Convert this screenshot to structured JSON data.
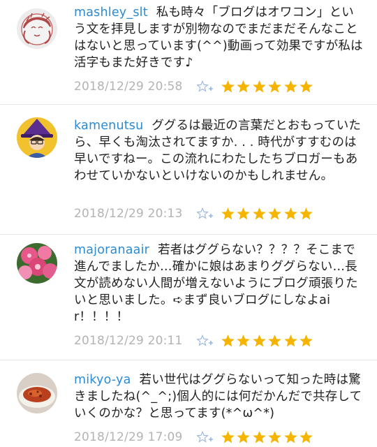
{
  "comments": [
    {
      "username": "mashley_slt",
      "text": "私も時々「ブログはオワコン」という文を拝見しますが別物なのでまだまだそんなことはないと思っています(^^)動画って効果ですが私は活字もまた好きです♪",
      "timestamp": "2018/12/29 20:58",
      "star_count": 6
    },
    {
      "username": "kamenutsu",
      "text": "ググるは最近の言葉だとおもっていたら、早くも淘汰されてますか. . . 時代がすすむのは早いですねー。この流れにわたしたちブロガーもあわせていかないといけないのかもしれません。",
      "timestamp": "2018/12/29 20:13",
      "star_count": 6
    },
    {
      "username": "majoranaair",
      "text": "若者はググらない？？？？そこまで進んでましたか…確かに娘はあまりググらない…長文が読めない人間が増えないようにブログ頑張りたいと思いました。➪まず良いブログにしなよair！！！！",
      "timestamp": "2018/12/29 20:11",
      "star_count": 6
    },
    {
      "username": "mikyo-ya",
      "text": "若い世代はググらないって知った時は驚きましたね(^_^;)個人的には何だかんだで共存していくのかな？と思ってます(*^ω^*)",
      "timestamp": "2018/12/29 17:09",
      "star_count": 6
    }
  ],
  "icons": {
    "add_star": "add-star-icon",
    "star": "star-icon"
  },
  "colors": {
    "username": "#2b8bd6",
    "star": "#f5b400",
    "add_star": "#9ab7e0",
    "timestamp": "#b3b3b3"
  }
}
